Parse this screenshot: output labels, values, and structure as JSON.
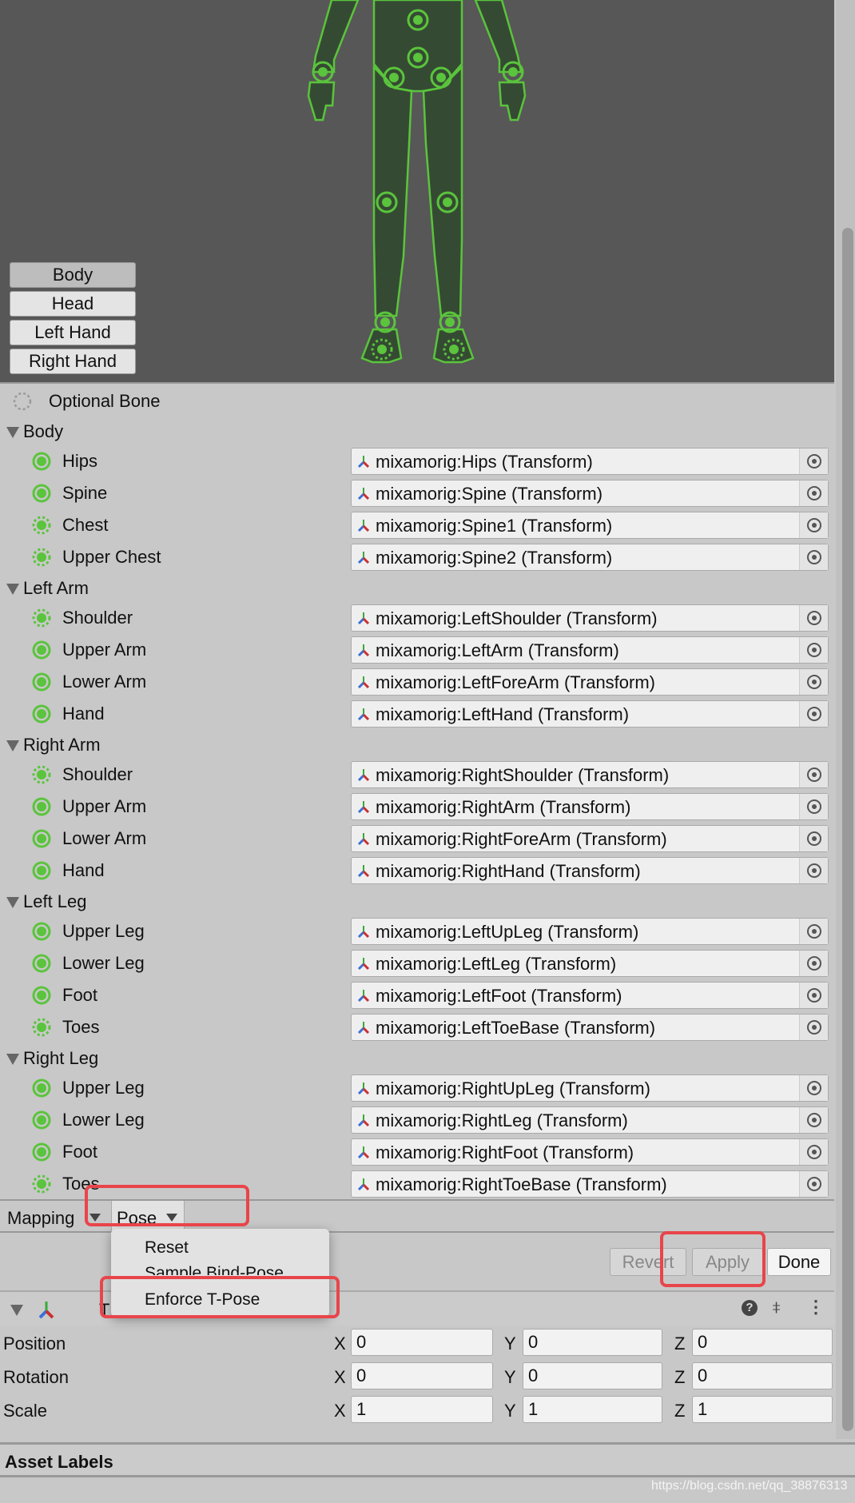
{
  "viewport": {
    "buttons": [
      "Body",
      "Head",
      "Left Hand",
      "Right Hand"
    ],
    "selected": "Body",
    "figure_color": "#5ac43c"
  },
  "legend": {
    "optional_bone": "Optional Bone"
  },
  "groups": [
    {
      "name": "Body",
      "bones": [
        {
          "label": "Hips",
          "value": "mixamorig:Hips (Transform)",
          "optional": false
        },
        {
          "label": "Spine",
          "value": "mixamorig:Spine (Transform)",
          "optional": false
        },
        {
          "label": "Chest",
          "value": "mixamorig:Spine1 (Transform)",
          "optional": true
        },
        {
          "label": "Upper Chest",
          "value": "mixamorig:Spine2 (Transform)",
          "optional": true
        }
      ]
    },
    {
      "name": "Left Arm",
      "bones": [
        {
          "label": "Shoulder",
          "value": "mixamorig:LeftShoulder (Transform)",
          "optional": true
        },
        {
          "label": "Upper Arm",
          "value": "mixamorig:LeftArm (Transform)",
          "optional": false
        },
        {
          "label": "Lower Arm",
          "value": "mixamorig:LeftForeArm (Transform)",
          "optional": false
        },
        {
          "label": "Hand",
          "value": "mixamorig:LeftHand (Transform)",
          "optional": false
        }
      ]
    },
    {
      "name": "Right Arm",
      "bones": [
        {
          "label": "Shoulder",
          "value": "mixamorig:RightShoulder (Transform)",
          "optional": true
        },
        {
          "label": "Upper Arm",
          "value": "mixamorig:RightArm (Transform)",
          "optional": false
        },
        {
          "label": "Lower Arm",
          "value": "mixamorig:RightForeArm (Transform)",
          "optional": false
        },
        {
          "label": "Hand",
          "value": "mixamorig:RightHand (Transform)",
          "optional": false
        }
      ]
    },
    {
      "name": "Left Leg",
      "bones": [
        {
          "label": "Upper Leg",
          "value": "mixamorig:LeftUpLeg (Transform)",
          "optional": false
        },
        {
          "label": "Lower Leg",
          "value": "mixamorig:LeftLeg (Transform)",
          "optional": false
        },
        {
          "label": "Foot",
          "value": "mixamorig:LeftFoot (Transform)",
          "optional": false
        },
        {
          "label": "Toes",
          "value": "mixamorig:LeftToeBase (Transform)",
          "optional": true
        }
      ]
    },
    {
      "name": "Right Leg",
      "bones": [
        {
          "label": "Upper Leg",
          "value": "mixamorig:RightUpLeg (Transform)",
          "optional": false
        },
        {
          "label": "Lower Leg",
          "value": "mixamorig:RightLeg (Transform)",
          "optional": false
        },
        {
          "label": "Foot",
          "value": "mixamorig:RightFoot (Transform)",
          "optional": false
        },
        {
          "label": "Toes",
          "value": "mixamorig:RightToeBase (Transform)",
          "optional": true
        }
      ]
    }
  ],
  "bottombar": {
    "mapping": "Mapping",
    "pose": "Pose"
  },
  "pose_menu": {
    "items": [
      "Reset",
      "Sample Bind-Pose",
      "Enforce T-Pose"
    ]
  },
  "actions": {
    "revert": "Revert",
    "apply": "Apply",
    "done": "Done"
  },
  "transform": {
    "header_partial": "T",
    "rows": [
      {
        "label": "Position",
        "x": "0",
        "y": "0",
        "z": "0"
      },
      {
        "label": "Rotation",
        "x": "0",
        "y": "0",
        "z": "0"
      },
      {
        "label": "Scale",
        "x": "1",
        "y": "1",
        "z": "1"
      }
    ],
    "axis": [
      "X",
      "Y",
      "Z"
    ]
  },
  "asset_labels": "Asset Labels",
  "watermark": "https://blog.csdn.net/qq_38876313",
  "colors": {
    "bone_green": "#5ac43c",
    "highlight": "#e8454a",
    "panel": "#c8c8c8"
  }
}
